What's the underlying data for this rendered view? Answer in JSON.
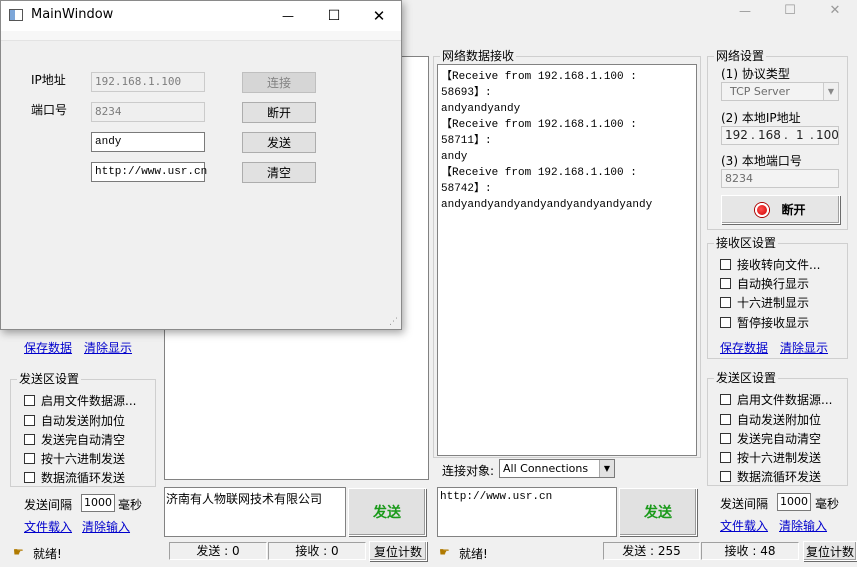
{
  "bg_window": {
    "window_controls": {
      "minimize": "—",
      "maximize": "☐",
      "close": "✕"
    }
  },
  "left_panel": {
    "save_data": "保存数据",
    "clear_display": "清除显示",
    "send_group": {
      "title": "发送区设置",
      "options": [
        "启用文件数据源...",
        "自动发送附加位",
        "发送完自动清空",
        "按十六进制发送",
        "数据流循环发送"
      ],
      "interval_label": "发送间隔",
      "interval_value": "1000",
      "interval_unit": "毫秒",
      "file_load": "文件载入",
      "clear_input": "清除输入"
    },
    "send_text": "济南有人物联网技术有限公司",
    "send_button": "发送"
  },
  "status_left": {
    "ready": "就绪!",
    "sent": "发送 : 0",
    "received": "接收 : 0",
    "reset": "复位计数"
  },
  "receive_area": {
    "title": "网络数据接收",
    "lines": [
      "【Receive from 192.168.1.100 : 58693】:",
      "andyandyandy",
      "【Receive from 192.168.1.100 : 58711】:",
      "andy",
      "【Receive from 192.168.1.100 : 58742】:",
      "andyandyandyandyandyandyandyandy"
    ]
  },
  "connection": {
    "label": "连接对象:",
    "value": "All Connections"
  },
  "right_send": {
    "text": "http://www.usr.cn",
    "button": "发送"
  },
  "status_right": {
    "ready": "就绪!",
    "sent": "发送 : 255",
    "received": "接收 : 48",
    "reset": "复位计数"
  },
  "network_settings": {
    "title": "网络设置",
    "protocol_label": "(1) 协议类型",
    "protocol_value": "TCP Server",
    "ip_label": "(2) 本地IP地址",
    "ip_parts": [
      "192",
      "168",
      "1",
      "100"
    ],
    "port_label": "(3) 本地端口号",
    "port_value": "8234",
    "disconnect": "断开"
  },
  "receive_settings": {
    "title": "接收区设置",
    "options": [
      "接收转向文件...",
      "自动换行显示",
      "十六进制显示",
      "暂停接收显示"
    ],
    "save_data": "保存数据",
    "clear_display": "清除显示"
  },
  "send_settings": {
    "title": "发送区设置",
    "options": [
      "启用文件数据源...",
      "自动发送附加位",
      "发送完自动清空",
      "按十六进制发送",
      "数据流循环发送"
    ],
    "interval_label": "发送间隔",
    "interval_value": "1000",
    "interval_unit": "毫秒",
    "file_load": "文件载入",
    "clear_input": "清除输入"
  },
  "main_window": {
    "title": "MainWindow",
    "controls": {
      "minimize": "—",
      "maximize": "☐",
      "close": "✕"
    },
    "ip_label": "IP地址",
    "ip_value": "192.168.1.100",
    "port_label": "端口号",
    "port_value": "8234",
    "message_value": "andy",
    "url_value": "http://www.usr.cn",
    "connect": "连接",
    "disconnect": "断开",
    "send": "发送",
    "clear": "清空"
  },
  "colors": {
    "accent_green": "#1a9a1a",
    "link_blue": "#0000cc",
    "indicator_red": "#e00000"
  }
}
